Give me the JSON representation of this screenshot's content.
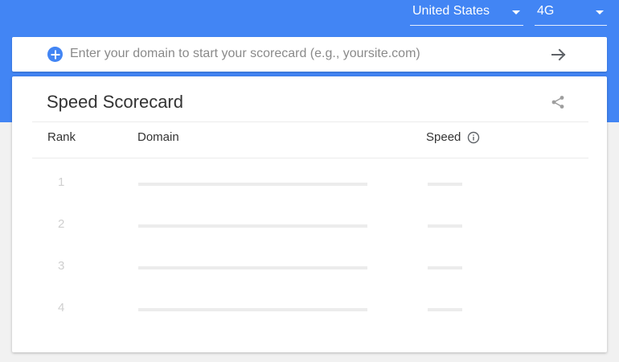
{
  "header": {
    "country_select": {
      "value": "United States"
    },
    "network_select": {
      "value": "4G"
    },
    "background_color": "#4285f4"
  },
  "search": {
    "placeholder": "Enter your domain to start your scorecard (e.g., yoursite.com)",
    "value": "",
    "add_icon": "plus-circle-icon",
    "submit_icon": "arrow-right-icon"
  },
  "scorecard": {
    "title": "Speed Scorecard",
    "share_icon": "share-icon",
    "columns": {
      "rank": "Rank",
      "domain": "Domain",
      "speed": "Speed",
      "speed_info_icon": "info-icon"
    },
    "rows": [
      {
        "rank": "1",
        "domain": "",
        "speed": ""
      },
      {
        "rank": "2",
        "domain": "",
        "speed": ""
      },
      {
        "rank": "3",
        "domain": "",
        "speed": ""
      },
      {
        "rank": "4",
        "domain": "",
        "speed": ""
      }
    ]
  }
}
